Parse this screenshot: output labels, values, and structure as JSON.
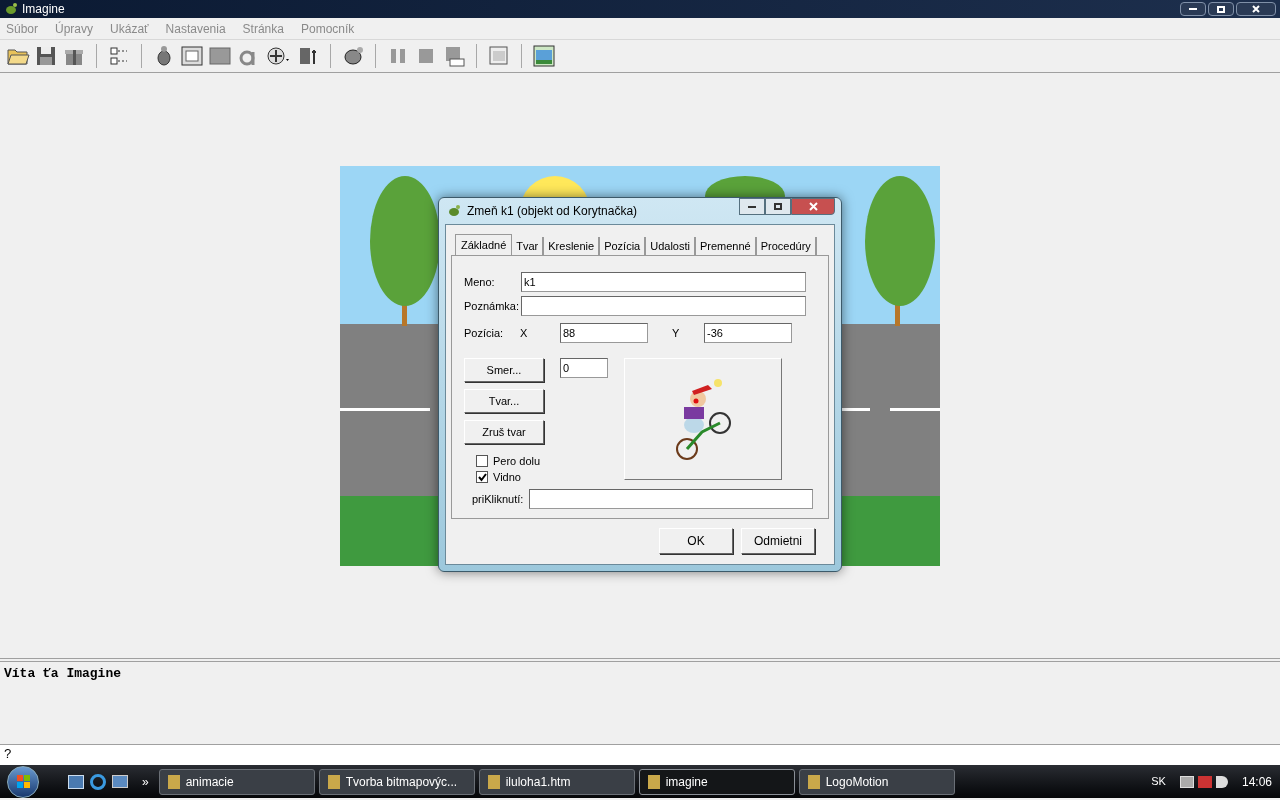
{
  "window": {
    "title": "Imagine"
  },
  "menu": [
    {
      "label": "Súbor"
    },
    {
      "label": "Úpravy"
    },
    {
      "label": "Ukázať"
    },
    {
      "label": "Nastavenia"
    },
    {
      "label": "Stránka"
    },
    {
      "label": "Pomocník"
    }
  ],
  "dialog": {
    "title": "Zmeň k1 (objekt od Korytnačka)",
    "tabs": [
      {
        "label": "Základné",
        "selected": true
      },
      {
        "label": "Tvar",
        "selected": false
      },
      {
        "label": "Kreslenie",
        "selected": false
      },
      {
        "label": "Pozícia",
        "selected": false
      },
      {
        "label": "Udalosti",
        "selected": false
      },
      {
        "label": "Premenné",
        "selected": false
      },
      {
        "label": "Procedúry",
        "selected": false
      }
    ],
    "name": {
      "label": "Meno:",
      "value": "k1"
    },
    "note": {
      "label": "Poznámka:"
    },
    "position": {
      "label": "Pozícia:",
      "x_label": "X",
      "x_value": "88",
      "y_label": "Y",
      "y_value": "-36"
    },
    "direction": {
      "button": "Smer...",
      "value": "0"
    },
    "shape_buttons": [
      "Tvar...",
      "Zruš tvar"
    ],
    "checkboxes": [
      {
        "label": "Pero dolu",
        "checked": false
      },
      {
        "label": "Vidno",
        "checked": true
      }
    ],
    "on_click": {
      "label": "priKliknutí:"
    },
    "buttons": [
      "OK",
      "Odmietni"
    ]
  },
  "console": {
    "text": "Víta ťa Imagine"
  },
  "command_line": {
    "value": "?"
  },
  "taskbar": {
    "quick_launch_more": "»",
    "tasks": [
      {
        "label": "animacie",
        "selected": false
      },
      {
        "label": "Tvorba bitmapovýc...",
        "selected": false
      },
      {
        "label": "iluloha1.htm",
        "selected": false
      },
      {
        "label": "imagine",
        "selected": true
      },
      {
        "label": "LogoMotion",
        "selected": false
      }
    ],
    "language": "SK",
    "clock": "14:06"
  }
}
